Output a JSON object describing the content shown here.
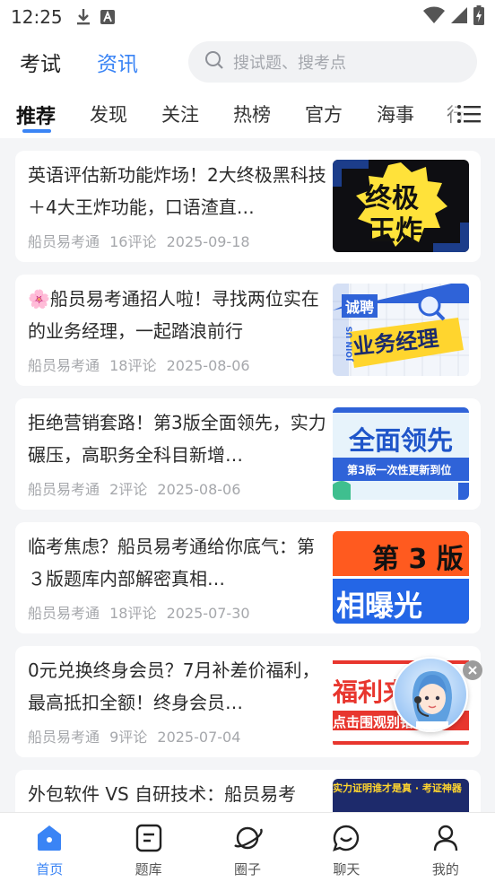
{
  "status_bar": {
    "time": "12:25",
    "download_icon": "download-icon",
    "a_icon": "a-icon",
    "wifi_icon": "wifi-icon",
    "signal_icon": "signal-icon",
    "battery_icon": "battery-icon"
  },
  "header": {
    "tabs": [
      {
        "label": "考试"
      },
      {
        "label": "资讯"
      }
    ],
    "active_tab": "资讯",
    "search": {
      "placeholder": "搜试题、搜考点",
      "icon": "search-icon"
    }
  },
  "categories": {
    "items": [
      {
        "label": "推荐"
      },
      {
        "label": "发现"
      },
      {
        "label": "关注"
      },
      {
        "label": "热榜"
      },
      {
        "label": "官方"
      },
      {
        "label": "海事"
      },
      {
        "label": "行"
      }
    ],
    "active": "推荐",
    "menu_icon": "menu-icon"
  },
  "articles": [
    {
      "title": "英语评估新功能炸场！2大终极黑科技＋4大王炸功能，口语渣直…",
      "source": "船员易考通",
      "comments": "16评论",
      "date": "2025-09-18",
      "thumb_text": [
        "终极",
        "王炸"
      ]
    },
    {
      "title": "🌸船员易考通招人啦！寻找两位实在的业务经理，一起踏浪前行",
      "source": "船员易考通",
      "comments": "18评论",
      "date": "2025-08-06",
      "thumb_text": [
        "诚聘",
        "业务经理",
        "JOIN US"
      ]
    },
    {
      "title": "拒绝营销套路！第3版全面领先，实力碾压，高职务全科目新增…",
      "source": "船员易考通",
      "comments": "2评论",
      "date": "2025-08-06",
      "thumb_text": [
        "全面领先",
        "第3版一次性更新到位"
      ]
    },
    {
      "title": "临考焦虑？船员易考通给你底气：第３版题库内部解密真相…",
      "source": "船员易考通",
      "comments": "18评论",
      "date": "2025-07-30",
      "thumb_text": [
        "第 3 版",
        "相曝光"
      ]
    },
    {
      "title": "0元兑换终身会员？7月补差价福利，最高抵扣全额！终身会员…",
      "source": "船员易考通",
      "comments": "9评论",
      "date": "2025-07-04",
      "thumb_text": [
        "福利来",
        "点击围观别错"
      ]
    },
    {
      "title": "外包软件 VS 自研技术：船员易考",
      "source": "",
      "comments": "",
      "date": "",
      "thumb_text": [
        "实力证明谁才是真 · 考证神器"
      ]
    }
  ],
  "floating": {
    "avatar_icon": "assistant-avatar-icon",
    "close_icon": "close-icon"
  },
  "bottom_nav": [
    {
      "label": "首页",
      "icon": "home-icon",
      "active": true
    },
    {
      "label": "题库",
      "icon": "question-bank-icon",
      "active": false
    },
    {
      "label": "圈子",
      "icon": "planet-icon",
      "active": false
    },
    {
      "label": "聊天",
      "icon": "chat-icon",
      "active": false
    },
    {
      "label": "我的",
      "icon": "profile-icon",
      "active": false
    }
  ],
  "colors": {
    "accent": "#3a84f5",
    "meta_text": "#a5a7ab",
    "background": "#f4f5f7"
  }
}
